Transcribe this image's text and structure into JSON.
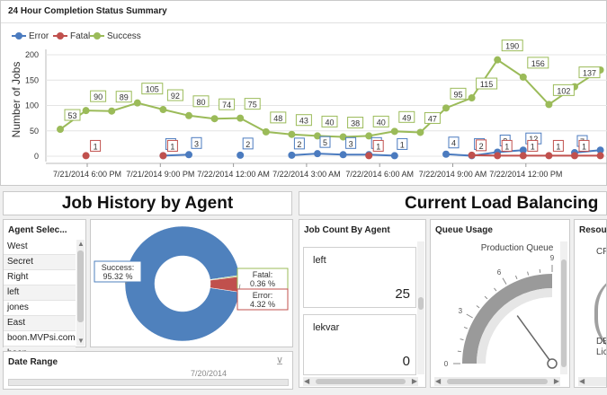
{
  "completion_panel": {
    "title": "24 Hour Completion Status Summary",
    "legend": [
      {
        "name": "Error",
        "color": "#4b7bbf"
      },
      {
        "name": "Fatal",
        "color": "#c0504d"
      },
      {
        "name": "Success",
        "color": "#9bbb59"
      }
    ]
  },
  "chart_data": [
    {
      "type": "line",
      "ylabel": "Number of Jobs",
      "ylim": [
        0,
        200
      ],
      "yticks": [
        "0",
        "50",
        "100",
        "150",
        "200"
      ],
      "xtick_labels": [
        "7/21/2014 6:00 PM",
        "7/21/2014 9:00 PM",
        "7/22/2014 12:00 AM",
        "7/22/2014 3:00 AM",
        "7/22/2014 6:00 AM",
        "7/22/2014 9:00 AM",
        "7/22/2014 12:00 PM"
      ],
      "series": [
        {
          "name": "Success",
          "color": "#9bbb59",
          "values": [
            53,
            90,
            89,
            105,
            92,
            80,
            74,
            75,
            48,
            43,
            40,
            38,
            40,
            49,
            47,
            95,
            115,
            190,
            156,
            102,
            137,
            170
          ]
        },
        {
          "name": "Error",
          "color": "#4b7bbf",
          "values": [
            null,
            null,
            null,
            null,
            1,
            3,
            null,
            2,
            null,
            2,
            5,
            3,
            3,
            1,
            null,
            4,
            1,
            8,
            12,
            null,
            7,
            12
          ]
        },
        {
          "name": "Fatal",
          "color": "#c0504d",
          "values": [
            null,
            1,
            null,
            null,
            1,
            null,
            null,
            null,
            null,
            null,
            null,
            null,
            1,
            null,
            null,
            null,
            2,
            1,
            1,
            1,
            1,
            1
          ]
        }
      ],
      "x_extent": [
        0,
        21.8
      ]
    },
    {
      "type": "pie",
      "style": "donut",
      "slices": [
        {
          "name": "Success",
          "value": 95.32,
          "label": "Success:\n95.32 %",
          "color": "#4f81bd"
        },
        {
          "name": "Fatal",
          "value": 0.36,
          "label": "Fatal:\n0.36 %",
          "color": "#9bbb59"
        },
        {
          "name": "Error",
          "value": 4.32,
          "label": "Error:\n4.32 %",
          "color": "#c0504d"
        }
      ]
    },
    {
      "type": "gauge",
      "title": "Production Queue",
      "ticks": [
        "0",
        "3",
        "6",
        "9"
      ],
      "range": [
        0,
        9
      ],
      "value": 0
    }
  ],
  "job_history_title": "Job History by Agent",
  "load_balancing_title": "Current Load Balancing",
  "agent_selector": {
    "title": "Agent Selec...",
    "items": [
      "West",
      "Secret",
      "Right",
      "left",
      "jones",
      "East",
      "boon.MVPsi.com",
      "boon"
    ]
  },
  "date_range": {
    "title": "Date Range",
    "value": "7/20/2014"
  },
  "job_count": {
    "title": "Job Count By Agent",
    "cards": [
      {
        "label": "left",
        "value": "25"
      },
      {
        "label": "lekvar",
        "value": "0"
      }
    ]
  },
  "queue_usage": {
    "title": "Queue Usage"
  },
  "resources": {
    "title": "Resour",
    "label_cpu": "CP",
    "label_db": "DB",
    "label_lic": "Lic"
  }
}
